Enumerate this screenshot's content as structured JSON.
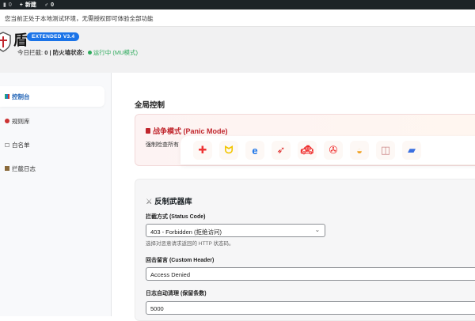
{
  "admin_bar": {
    "comments": "0",
    "new_label": "新建",
    "updates": "0"
  },
  "notice": "您当前正处于本地测试环境，无需授权即可体验全部功能",
  "header": {
    "brand": "盾",
    "badge": "EXTENDED V3.4",
    "stats_label": "今日拦截:",
    "stats_value": "0",
    "firewall_label": "| 防火墙状态:",
    "firewall_status": "运行中 (MU模式)"
  },
  "sidebar": {
    "items": [
      {
        "label": "控制台",
        "icon": "chart-icon"
      },
      {
        "label": "规则库",
        "icon": "target-icon"
      },
      {
        "label": "白名单",
        "icon": "id-card-icon"
      },
      {
        "label": "拦截日志",
        "icon": "scroll-icon"
      }
    ]
  },
  "main": {
    "section_title": "全局控制",
    "panic": {
      "title": "战争模式 (Panic Mode)",
      "desc": "强制检查所有"
    },
    "dock_apps": [
      "app-1",
      "app-2",
      "app-3",
      "app-4",
      "app-5",
      "app-6",
      "app-7",
      "app-8",
      "app-9"
    ],
    "arsenal": {
      "title": "反制武器库",
      "status_label": "拦截方式 (Status Code)",
      "status_value": "403 - Forbidden (拒绝访问)",
      "status_help": "选择对恶意请求返回的 HTTP 状态码。",
      "header_label": "回击留言 (Custom Header)",
      "header_value": "Access Denied",
      "log_label": "日志自动清理 (保留条数)",
      "log_value": "5000"
    }
  }
}
